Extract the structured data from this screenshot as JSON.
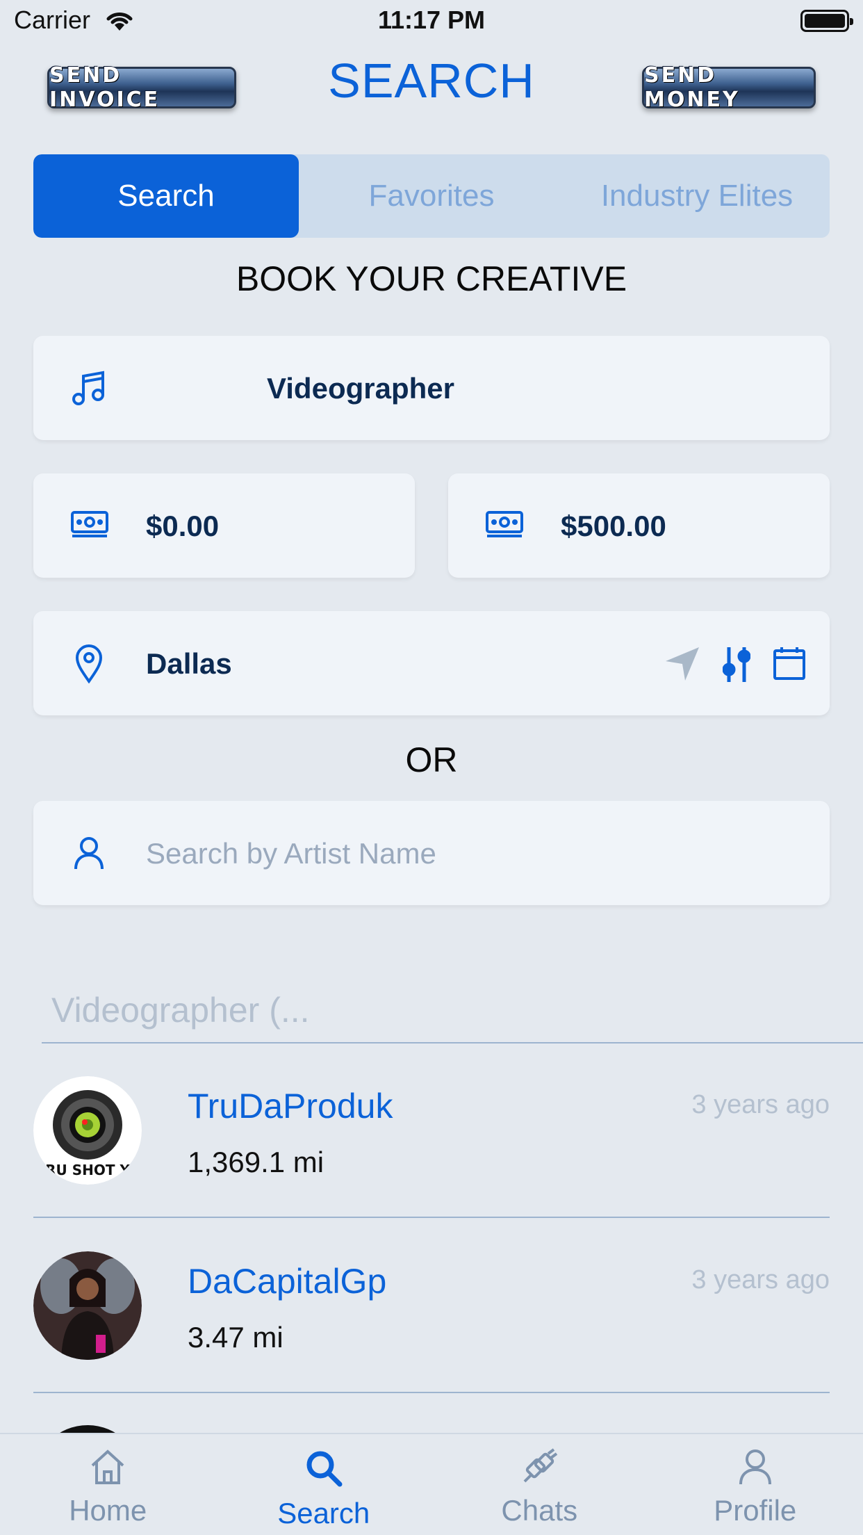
{
  "status_bar": {
    "carrier": "Carrier",
    "time": "11:17 PM"
  },
  "header": {
    "title": "SEARCH",
    "left_button": "SEND INVOICE",
    "right_button": "SEND MONEY"
  },
  "segments": [
    {
      "label": "Search",
      "active": true
    },
    {
      "label": "Favorites",
      "active": false
    },
    {
      "label": "Industry Elites",
      "active": false
    }
  ],
  "book_title": "BOOK YOUR CREATIVE",
  "filters": {
    "category": "Videographer",
    "min_price": "$0.00",
    "max_price": "$500.00",
    "location": "Dallas",
    "or_label": "OR",
    "artist_placeholder": "Search by Artist Name",
    "artist_value": ""
  },
  "results": {
    "section_title": "Videographer (...",
    "items": [
      {
        "name": "TruDaProduk",
        "distance": "1,369.1 mi",
        "time": "3 years ago",
        "avatar_text": "TRU SHOT YA"
      },
      {
        "name": "DaCapitalGp",
        "distance": "3.47 mi",
        "time": "3 years ago"
      }
    ]
  },
  "tabbar": {
    "items": [
      {
        "label": "Home",
        "icon": "home-icon",
        "active": false
      },
      {
        "label": "Search",
        "icon": "search-icon",
        "active": true
      },
      {
        "label": "Chats",
        "icon": "chats-icon",
        "active": false
      },
      {
        "label": "Profile",
        "icon": "profile-icon",
        "active": false
      }
    ]
  },
  "colors": {
    "accent": "#0b62d8",
    "background": "#e4e9ef",
    "card": "#f0f4f9",
    "muted": "#b4c0cf"
  }
}
